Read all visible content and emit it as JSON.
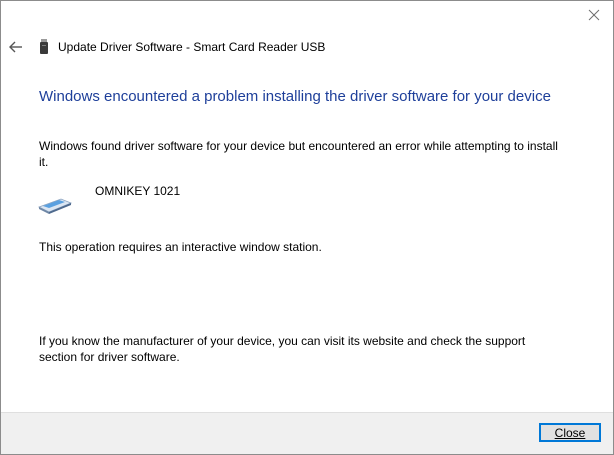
{
  "window": {
    "title": "Update Driver Software - Smart Card Reader USB"
  },
  "content": {
    "heading": "Windows encountered a problem installing the driver software for your device",
    "description": "Windows found driver software for your device but encountered an error while attempting to install it.",
    "device_name": "OMNIKEY 1021",
    "error_message": "This operation requires an interactive window station.",
    "help_text": "If you know the manufacturer of your device, you can visit its website and check the support section for driver software."
  },
  "footer": {
    "close_label": "Close"
  },
  "icons": {
    "back": "back-arrow-icon",
    "window_close": "close-icon",
    "device": "smart-card-reader-icon",
    "header_device": "usb-reader-icon"
  },
  "colors": {
    "heading": "#1e3f9a",
    "footer_bg": "#f0f0f0",
    "button_border": "#0078d7"
  }
}
